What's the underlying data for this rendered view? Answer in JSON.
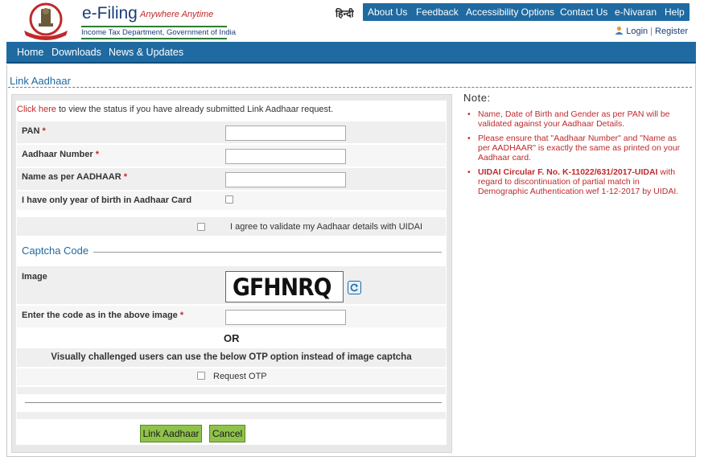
{
  "header": {
    "brand_title": "e-Filing",
    "brand_tagline": "Anywhere Anytime",
    "brand_subtitle": "Income Tax Department, Government of India",
    "emblem_caption": "INCOME TAX DEPARTMENT",
    "hindi_link": "हिन्दी",
    "top_nav": [
      "About Us",
      "Feedback",
      "Accessibility Options",
      "Contact Us",
      "e-Nivaran",
      "Help"
    ],
    "login_label": "Login",
    "register_label": "Register"
  },
  "main_nav": [
    "Home",
    "Downloads",
    "News & Updates"
  ],
  "page": {
    "section_title": "Link Aadhaar",
    "click_here": "Click here",
    "click_line_rest": " to view the status if you have already submitted Link Aadhaar request."
  },
  "form": {
    "pan_label": "PAN",
    "aadhaar_label": "Aadhaar Number",
    "name_label": "Name as per AADHAAR",
    "yob_label": "I have only year of birth in Aadhaar Card",
    "agree_label": "I agree to validate my Aadhaar details with UIDAI",
    "required_mark": "*",
    "captcha_section": "Captcha Code",
    "image_label": "Image",
    "captcha_text": "GFHNRQ",
    "enter_code_label": "Enter the code as in the above image",
    "or_text": "OR",
    "visually_challenged": "Visually challenged users can use the below OTP option instead of image captcha",
    "request_otp_label": "Request OTP",
    "pan_value": "",
    "aadhaar_value": "",
    "name_value": "",
    "code_value": ""
  },
  "buttons": {
    "link_aadhaar": "Link Aadhaar",
    "cancel": "Cancel"
  },
  "notes": {
    "title": "Note:",
    "items": [
      "Name, Date of Birth and Gender as per PAN will be validated against your Aadhaar Details.",
      "Please ensure that \"Aadhaar Number\" and \"Name as per AADHAAR\" is exactly the same as printed on your Aadhaar card.",
      "UIDAI Circular F. No. K-11022/631/2017-UIDAI"
    ],
    "circular_rest": " with regard to discontinuation of partial match in Demographic Authentication wef 1-12-2017 by UIDAI."
  },
  "colors": {
    "nav_blue": "#1f6aa1",
    "brand_red": "#c0292b",
    "button_green": "#8fc24a"
  }
}
